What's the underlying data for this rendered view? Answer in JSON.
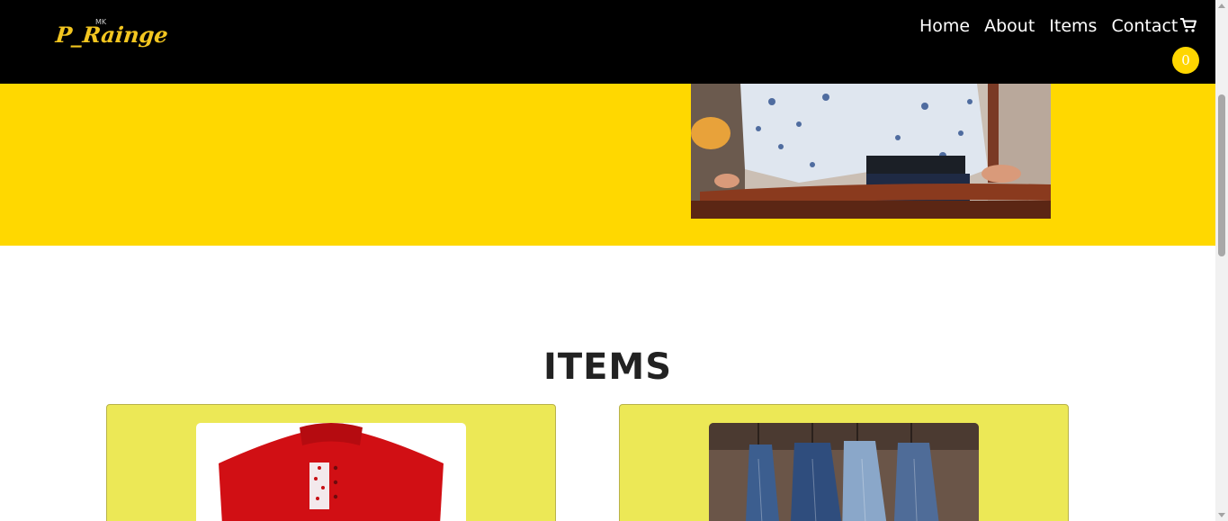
{
  "navbar": {
    "brand": "P_Rainge",
    "brand_sup": "MK",
    "links": [
      "Home",
      "About",
      "Items",
      "Contact"
    ],
    "cart_count": "0",
    "colors": {
      "background": "#000000",
      "brand": "#f3c620",
      "badge": "#ffd600"
    }
  },
  "hero": {
    "background": "#ffd800",
    "image": "man-in-floral-shirt-photo"
  },
  "items_section": {
    "heading": "ITEMS",
    "cards": [
      {
        "image": "red-polo-shirt-photo"
      },
      {
        "image": "hanging-jeans-photo"
      }
    ],
    "card_color": "#ece856"
  }
}
